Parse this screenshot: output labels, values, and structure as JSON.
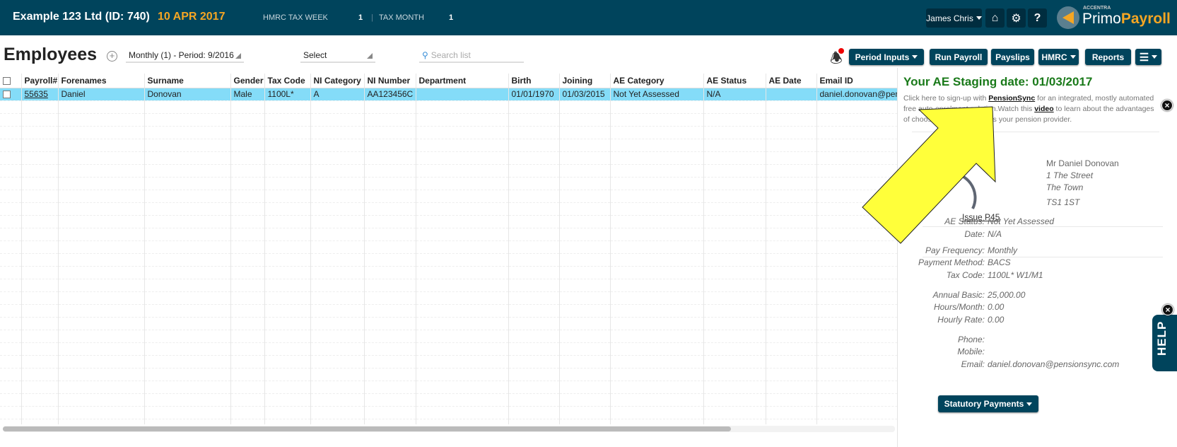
{
  "header": {
    "company": "Example 123 Ltd (ID: 740)",
    "date": "10 APR 2017",
    "tax_week_label": "HMRC TAX WEEK",
    "tax_week": "1",
    "separator": "|",
    "tax_month_label": "TAX MONTH",
    "tax_month": "1",
    "user": "James Chris",
    "help_glyph": "?",
    "logo_small": "ACCENTRA",
    "logo_primo": "Primo",
    "logo_payroll": "Payroll"
  },
  "toolbar": {
    "title": "Employees",
    "period": "Monthly (1) - Period: 9/2016",
    "select": "Select",
    "search_placeholder": "Search list",
    "buttons": {
      "period_inputs": "Period Inputs",
      "run_payroll": "Run Payroll",
      "payslips": "Payslips",
      "hmrc": "HMRC",
      "reports": "Reports"
    }
  },
  "table": {
    "columns": [
      "Payroll#",
      "Forenames",
      "Surname",
      "Gender",
      "Tax Code",
      "NI Category",
      "NI Number",
      "Department",
      "Birth",
      "Joining",
      "AE Category",
      "AE Status",
      "AE Date",
      "Email ID"
    ],
    "rows": [
      [
        "55635",
        "Daniel",
        "Donovan",
        "Male",
        "1100L*",
        "A",
        "AA123456C",
        "",
        "01/01/1970",
        "01/03/2015",
        "Not Yet Assessed",
        "N/A",
        "",
        "daniel.donovan@pensionsync.com"
      ]
    ]
  },
  "panel": {
    "staging": "Your AE Staging date: 01/03/2017",
    "promo_1": "Click here to sign-up with ",
    "promo_link": "PensionSync",
    "promo_2": " for an integrated, mostly automated",
    "promo_3": "free auto-enrolment solution.Watch this ",
    "promo_video": "video",
    "promo_4": " to learn about the advantages",
    "promo_5": "of choosing PensionSync as your pension provider.",
    "name": "Mr Daniel Donovan",
    "addr1": "1 The Street",
    "addr2": "The Town",
    "postcode": "TS1 1ST",
    "issue_p45": "Issue P45",
    "fields": [
      {
        "label": "AE Status:",
        "value": "Not Yet Assessed"
      },
      {
        "label": "Date:",
        "value": "N/A"
      },
      {
        "label": "Pay Frequency:",
        "value": "Monthly"
      },
      {
        "label": "Payment Method:",
        "value": "BACS"
      },
      {
        "label": "Tax Code:",
        "value": "1100L* W1/M1"
      },
      {
        "label": "Annual Basic:",
        "value": "25,000.00"
      },
      {
        "label": "Hours/Month:",
        "value": "0.00"
      },
      {
        "label": "Hourly Rate:",
        "value": "0.00"
      },
      {
        "label": "Phone:",
        "value": ""
      },
      {
        "label": "Mobile:",
        "value": ""
      },
      {
        "label": "Email:",
        "value": "daniel.donovan@pensionsync.com"
      }
    ],
    "statutory": "Statutory Payments",
    "help": "HELP"
  },
  "colors": {
    "header_bg": "#00445c",
    "accent_orange": "#f5a623",
    "selected_row": "#84dcf8",
    "staging_green": "#1a7a1a",
    "arrow": "#ffff3a"
  }
}
